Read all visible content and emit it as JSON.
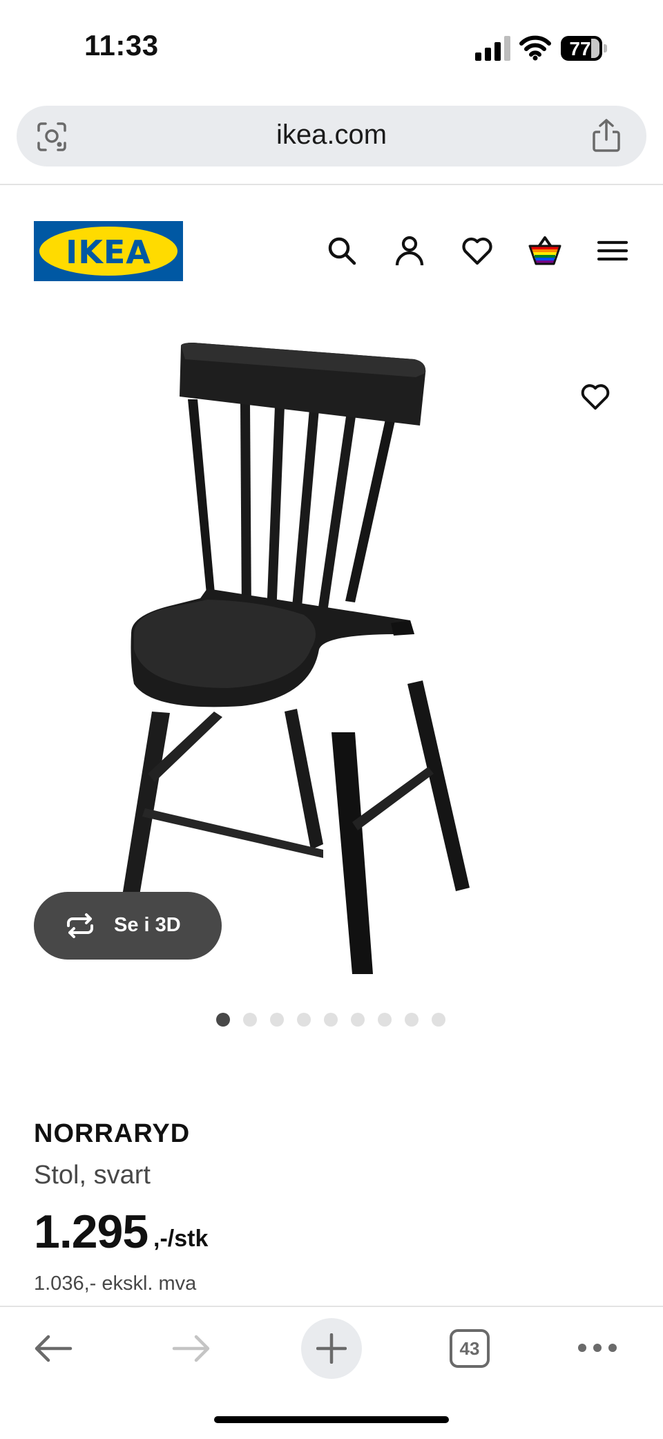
{
  "status_bar": {
    "time": "11:33",
    "battery": "77"
  },
  "browser": {
    "url": "ikea.com",
    "open_tabs": "43"
  },
  "header": {
    "logo": "IKEA",
    "icons": [
      "search-icon",
      "account-icon",
      "favourites-icon",
      "shopping-bag-icon",
      "menu-icon"
    ]
  },
  "gallery": {
    "view_3d_label": "Se i 3D",
    "image_count": 9,
    "active_index": 0
  },
  "product": {
    "name": "NORRARYD",
    "description": "Stol, svart",
    "price": "1.295",
    "price_suffix": ",-/stk",
    "price_excl_vat": "1.036,- ekskl. mva"
  },
  "colors": {
    "ikea_blue": "#0058a3",
    "ikea_yellow": "#ffdb00",
    "button_dark": "#484848"
  }
}
